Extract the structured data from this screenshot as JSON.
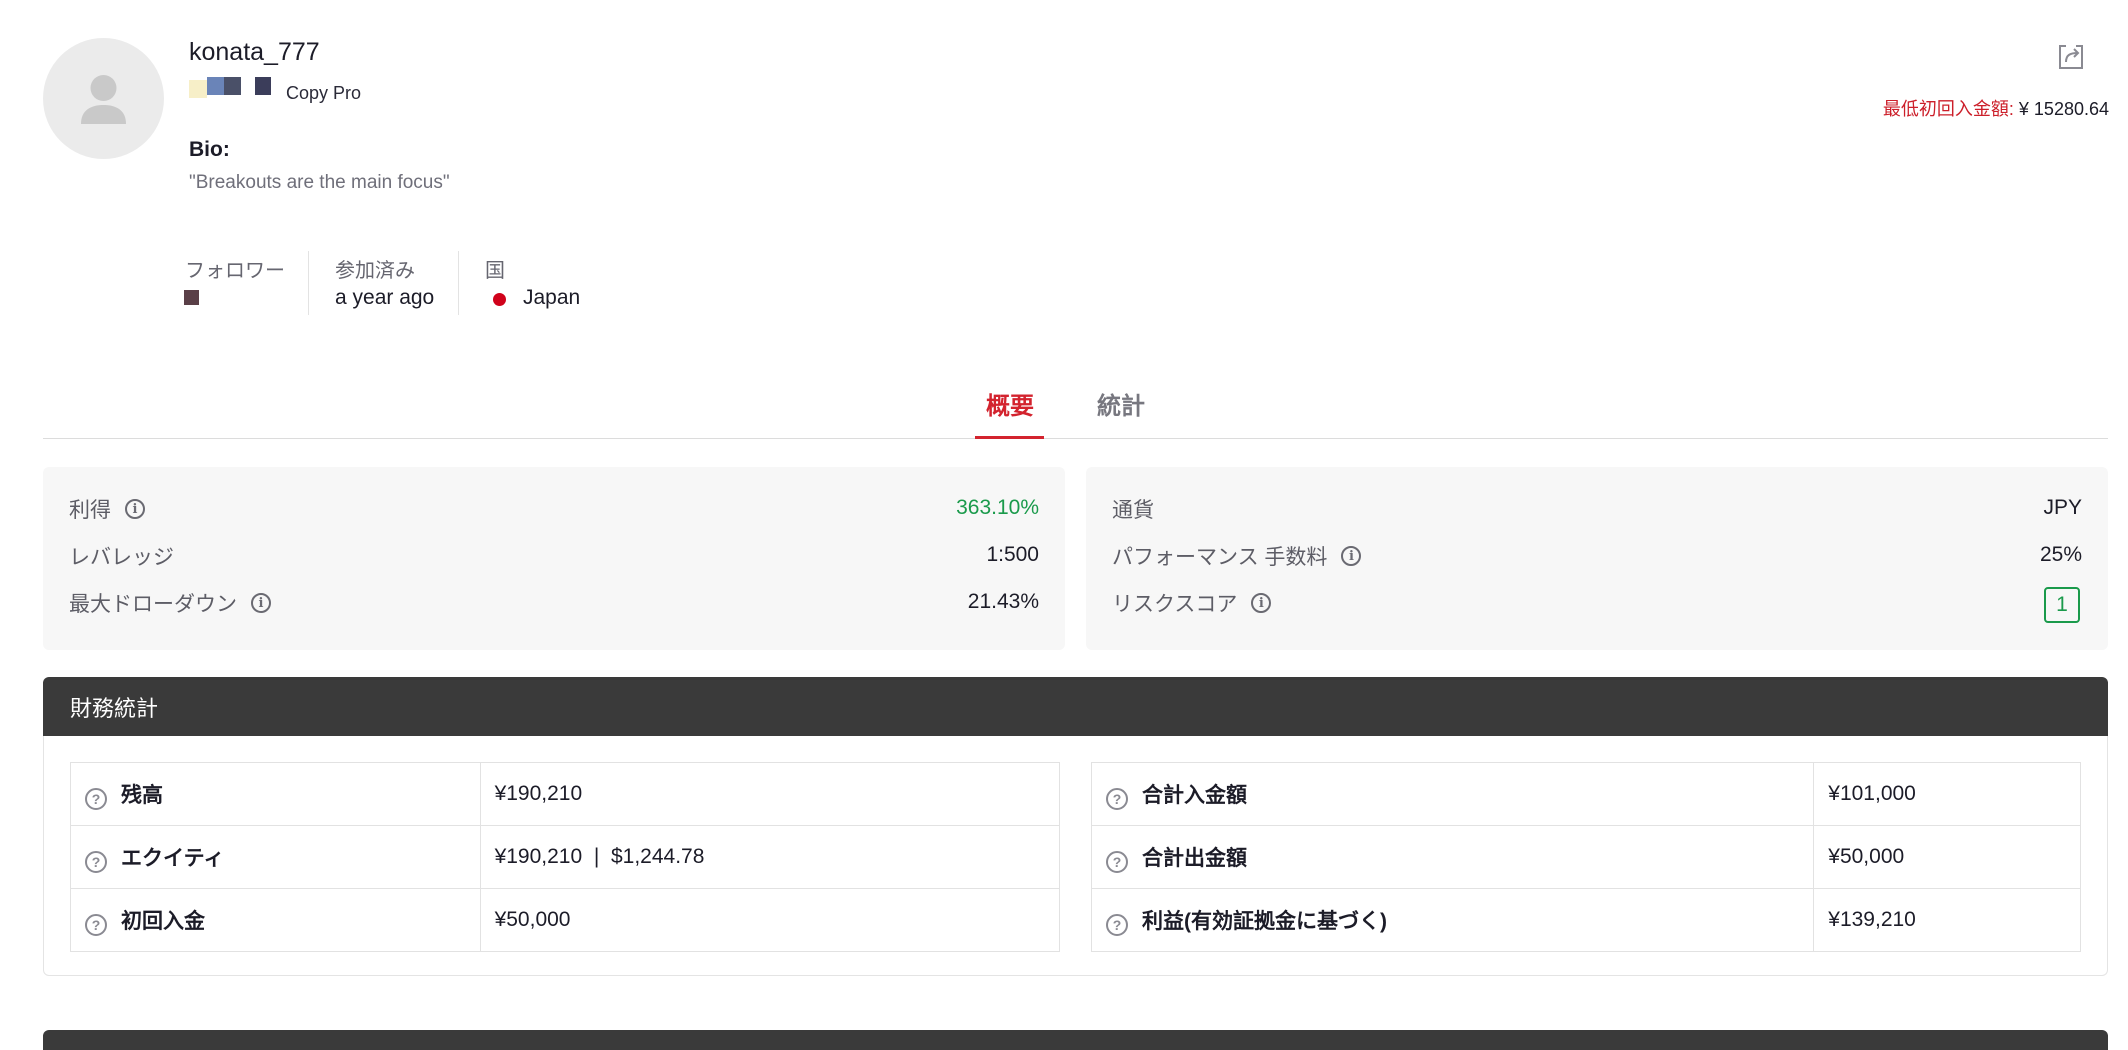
{
  "profile": {
    "username": "konata_777",
    "badge_label": "Copy Pro",
    "bio_label": "Bio:",
    "bio_text": "\"Breakouts are the main focus\"",
    "min_deposit_label": "最低初回入金額:",
    "min_deposit_value": "¥ 15280.64"
  },
  "stats": {
    "followers_label": "フォロワー",
    "joined_label": "参加済み",
    "joined_value": "a year ago",
    "country_label": "国",
    "country_value": "Japan"
  },
  "tabs": [
    {
      "label": "概要",
      "active": true
    },
    {
      "label": "統計",
      "active": false
    }
  ],
  "overview": {
    "left": [
      {
        "label": "利得",
        "value": "363.10%",
        "info": true
      },
      {
        "label": "レバレッジ",
        "value": "1:500",
        "info": false
      },
      {
        "label": "最大ドローダウン",
        "value": "21.43%",
        "info": true
      }
    ],
    "right": [
      {
        "label": "通貨",
        "value": "JPY",
        "info": false
      },
      {
        "label": "パフォーマンス 手数料",
        "value": "25%",
        "info": true
      },
      {
        "label": "リスクスコア",
        "value": "1",
        "info": true
      }
    ]
  },
  "financial": {
    "title": "財務統計",
    "left": [
      {
        "label": "残高",
        "value": "¥190,210"
      },
      {
        "label": "エクイティ",
        "value": "¥190,210  |  $1,244.78"
      },
      {
        "label": "初回入金",
        "value": "¥50,000"
      }
    ],
    "right": [
      {
        "label": "合計入金額",
        "value": "¥101,000"
      },
      {
        "label": "合計出金額",
        "value": "¥50,000"
      },
      {
        "label": "利益(有効証拠金に基づく)",
        "value": "¥139,210"
      }
    ]
  },
  "icons": {
    "avatar": "user-placeholder-icon",
    "share": "share-icon",
    "info": "info-icon",
    "question": "question-icon"
  },
  "colors": {
    "accent_red": "#d3232e",
    "positive_green": "#1a9a4b",
    "header_dark": "#3a3a3a",
    "country_dot": "#d0021b"
  }
}
